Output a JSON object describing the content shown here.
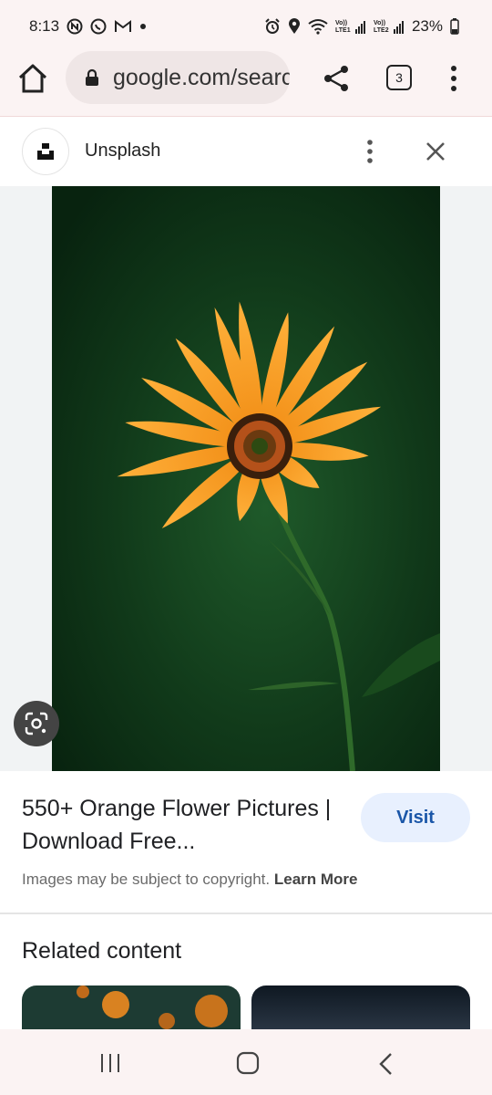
{
  "status_bar": {
    "time": "8:13",
    "battery": "23%",
    "icons": [
      "notification-icon",
      "whatsapp-icon",
      "gmail-icon",
      "dot-icon",
      "alarm-icon",
      "location-icon",
      "wifi-icon",
      "signal-lte1-icon",
      "signal-lte2-icon",
      "battery-icon"
    ],
    "lte1_label": "Vo))\nLTE1",
    "lte2_label": "Vo))\nLTE2"
  },
  "toolbar": {
    "url": "google.com/search",
    "tab_count": "3"
  },
  "source": {
    "name": "Unsplash"
  },
  "result": {
    "title": "550+ Orange Flower Pictures | Download Free...",
    "visit_label": "Visit",
    "copyright_text": "Images may be subject to copyright.",
    "learn_more": "Learn More"
  },
  "related": {
    "heading": "Related content"
  },
  "colors": {
    "accent": "#1a56a8",
    "visit_bg": "#e8f0fe",
    "flower": "#f7931e"
  }
}
